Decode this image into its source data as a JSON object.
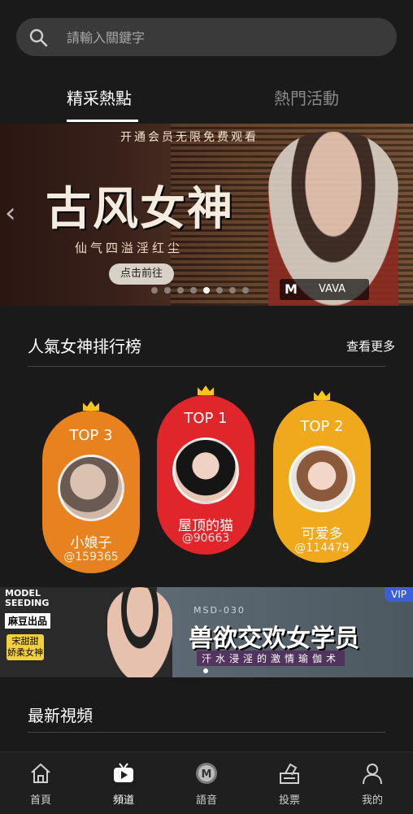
{
  "search": {
    "placeholder": "請輸入關鍵字"
  },
  "tabs": [
    {
      "label": "精采熱點",
      "active": true
    },
    {
      "label": "熱門活動",
      "active": false
    }
  ],
  "banner": {
    "top_line": "开通会员无限免费观看",
    "title": "古风女神",
    "subtitle": "仙气四溢淫红尘",
    "cta": "点击前往",
    "brand_mark": "M",
    "brand_name": "VAVA",
    "slide_count": 8,
    "active_slide": 4
  },
  "ranking": {
    "title": "人氣女神排行榜",
    "more": "查看更多",
    "cards": [
      {
        "rank": "TOP 3",
        "name": "小娘子",
        "uid": "@159365",
        "color": "#e8821e"
      },
      {
        "rank": "TOP 1",
        "name": "屋顶的猫",
        "uid": "@90663",
        "color": "#e0262a"
      },
      {
        "rank": "TOP 2",
        "name": "可爱多",
        "uid": "@114479",
        "color": "#f0a81c"
      }
    ]
  },
  "ad": {
    "logo_line1": "MODEL",
    "logo_line2": "SEEDING",
    "studio": "麻豆出品",
    "tag": "宋甜甜 娇柔女神",
    "code": "MSD-030",
    "headline": "兽欲交欢女学员",
    "sub": "汗水浸淫的激情瑜伽术",
    "vip": "VIP"
  },
  "latest": {
    "title": "最新視頻"
  },
  "nav": [
    {
      "label": "首頁",
      "icon": "home-icon"
    },
    {
      "label": "頻道",
      "icon": "tv-icon",
      "active": true
    },
    {
      "label": "語音",
      "icon": "voice-icon"
    },
    {
      "label": "投票",
      "icon": "vote-icon"
    },
    {
      "label": "我的",
      "icon": "user-icon"
    }
  ]
}
